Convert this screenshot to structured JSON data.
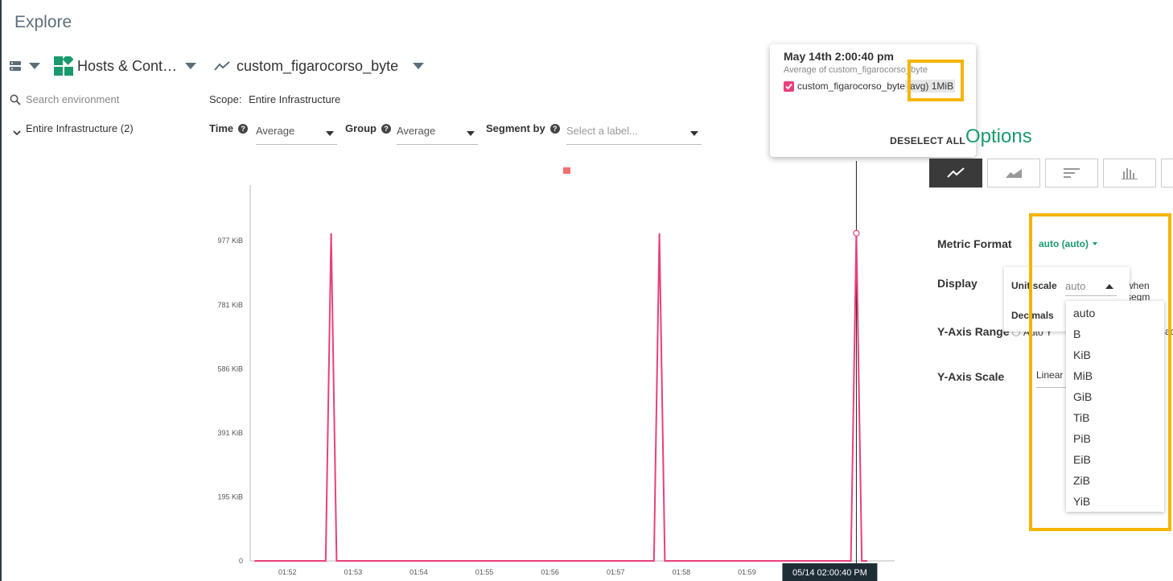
{
  "page": {
    "title": "Explore"
  },
  "toolbar": {
    "scope_selector": "Hosts & Cont…",
    "metric_selector": "custom_figarocorso_byte"
  },
  "sidebar": {
    "search_placeholder": "Search environment",
    "tree_root": "Entire Infrastructure (2)"
  },
  "scope": {
    "label": "Scope:",
    "value": "Entire Infrastructure"
  },
  "filters": {
    "time_label": "Time",
    "time_value": "Average",
    "group_label": "Group",
    "group_value": "Average",
    "segment_label": "Segment by",
    "segment_placeholder": "Select a label..."
  },
  "tooltip": {
    "timestamp": "May 14th 2:00:40 pm",
    "subtitle": "Average of custom_figarocorso_byte",
    "series_label": "custom_figarocorso_byte",
    "series_suffix": "(avg) 1MiB",
    "deselect_all": "DESELECT ALL"
  },
  "options_panel": {
    "title_partial": "Options",
    "metric_format_label": "Metric Format",
    "metric_format_value": "auto (auto)",
    "display_label": "Display",
    "display_trailing": "when segm",
    "yaxis_range_label": "Y-Axis Range",
    "yaxis_range_partial": "Auto Y",
    "yaxis_range_trailing": "ac",
    "yaxis_scale_label": "Y-Axis Scale",
    "yaxis_scale_value": "Linear",
    "unit_scale_label": "Unit scale",
    "unit_scale_value": "auto",
    "decimals_label": "Decimals",
    "unit_options": [
      "auto",
      "B",
      "KiB",
      "MiB",
      "GiB",
      "TiB",
      "PiB",
      "EiB",
      "ZiB",
      "YiB"
    ]
  },
  "colors": {
    "series": "#e8407b",
    "accent": "#1a9a6c",
    "highlight": "#f5b400",
    "legend_marker": "#f07070"
  },
  "chart_data": {
    "type": "line",
    "series": [
      {
        "name": "custom_figarocorso_byte",
        "x": [
          "01:51:30",
          "01:52:35",
          "01:52:40",
          "01:52:45",
          "01:57:35",
          "01:57:40",
          "01:57:45",
          "02:00:35",
          "02:00:40",
          "02:00:45",
          "02:00:50"
        ],
        "values": [
          0,
          0,
          1000,
          0,
          0,
          1000,
          0,
          0,
          1000,
          0,
          0
        ]
      }
    ],
    "yunit": "KiB",
    "ylim": [
      0,
      1147
    ],
    "yticks": [
      {
        "value": 0,
        "label": "0"
      },
      {
        "value": 195,
        "label": "195 KiB"
      },
      {
        "value": 391,
        "label": "391 KiB"
      },
      {
        "value": 586,
        "label": "586 KiB"
      },
      {
        "value": 781,
        "label": "781 KiB"
      },
      {
        "value": 977,
        "label": "977 KiB"
      }
    ],
    "xticks": [
      "01:52",
      "01:53",
      "01:54",
      "01:55",
      "01:56",
      "01:57",
      "01:58",
      "01:59"
    ],
    "xtick_partial": "01",
    "hover_time_label": "05/14 02:00:40 PM",
    "grid": false
  }
}
